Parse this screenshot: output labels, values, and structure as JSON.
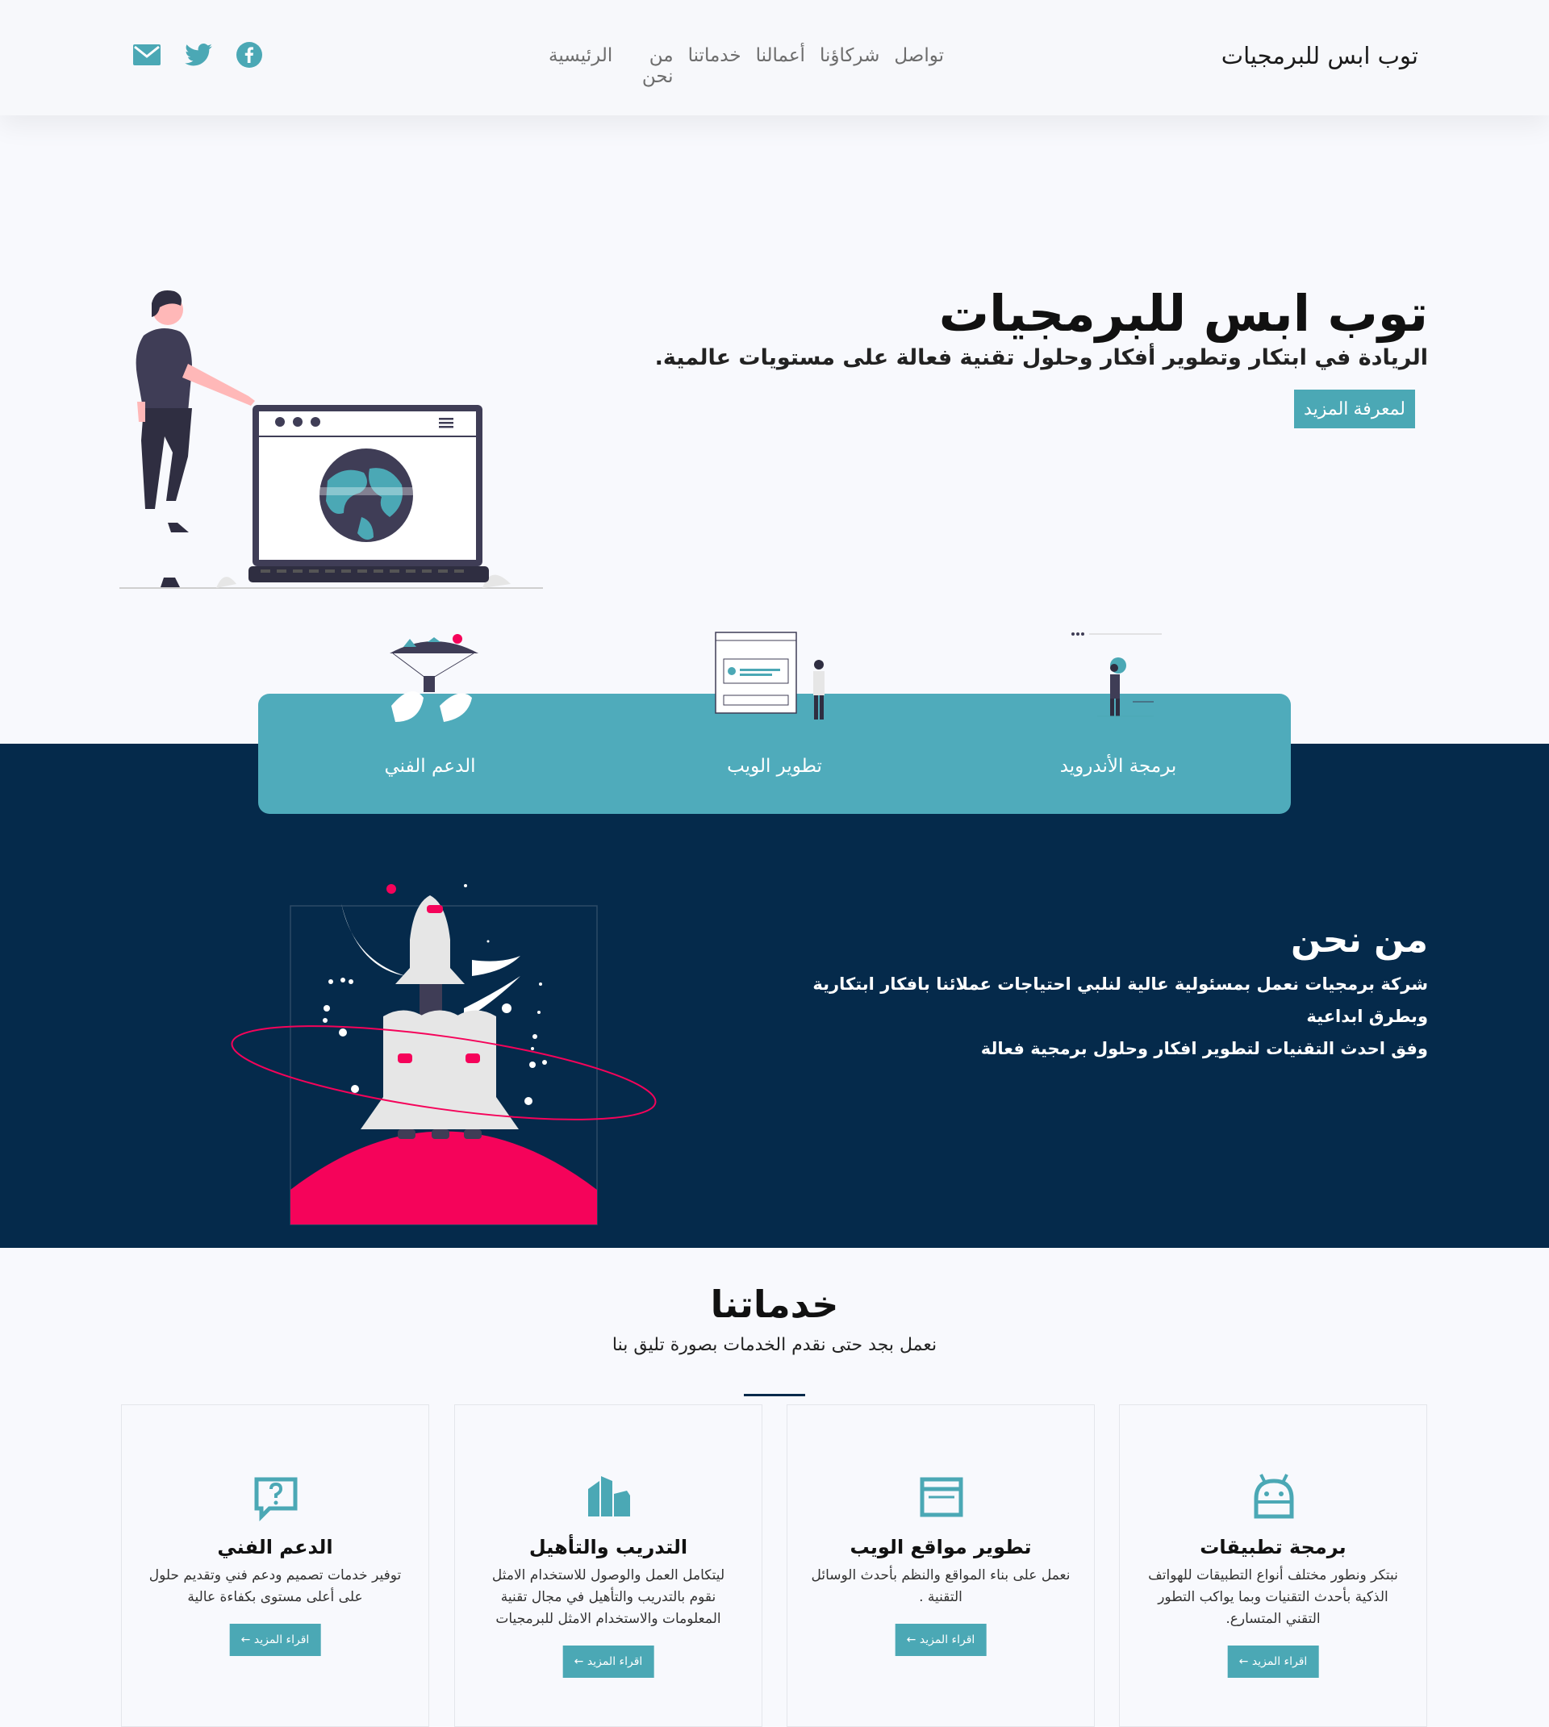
{
  "header": {
    "brand": "توب ابس للبرمجيات",
    "nav": [
      "الرئيسية",
      "من نحن",
      "خدماتنا",
      "أعمالنا",
      "شركاؤنا",
      "تواصل"
    ]
  },
  "social": {
    "icons": [
      "facebook-icon",
      "twitter-icon",
      "mail-icon"
    ],
    "color": "#4ba8b5"
  },
  "hero": {
    "title": "توب ابس للبرمجيات",
    "subtitle": "الريادة في ابتكار وتطوير أفكار وحلول تقنية فعالة على مستويات عالمية.",
    "button": "لمعرفة المزيد"
  },
  "features": [
    {
      "label": "برمجة الأندرويد"
    },
    {
      "label": "تطوير الويب"
    },
    {
      "label": "الدعم الفني"
    }
  ],
  "about": {
    "title": "من نحن",
    "line1": "شركة برمجيات نعمل بمسئولية عالية لنلبي احتياجات عملائنا بافكار ابتكارية وبطرق ابداعية",
    "line2": "وفق احدث التقنيات لتطوير افكار وحلول برمجية فعالة"
  },
  "services": {
    "title": "خدماتنا",
    "subtitle": "نعمل بجد حتى نقدم الخدمات بصورة تليق بنا",
    "cards": [
      {
        "icon": "android-icon",
        "title": "برمجة تطبيقات",
        "text": "نبتكر ونطور مختلف أنواع التطبيقات للهواتف الذكية بأحدث التقنيات وبما يواكب التطور التقني المتسارع.",
        "button": "اقراء المزيد ←"
      },
      {
        "icon": "browser-icon",
        "title": "تطوير مواقع الويب",
        "text": "نعمل على بناء المواقع والنظم بأحدث الوسائل التقنية .",
        "button": "اقراء المزيد ←"
      },
      {
        "icon": "buildings-icon",
        "title": "التدريب والتأهيل",
        "text": "ليتكامل العمل والوصول للاستخدام الامثل نقوم بالتدريب والتأهيل في مجال تقنية المعلومات والاستخدام الامثل للبرمجيات",
        "button": "اقراء المزيد ←"
      },
      {
        "icon": "question-chat-icon",
        "title": "الدعم الفني",
        "text": "توفير خدمات تصميم ودعم فني وتقديم حلول على أعلى مستوى بكفاءة عالية",
        "button": "اقراء المزيد ←"
      }
    ]
  },
  "colors": {
    "accent": "#4ba8b5",
    "dark": "#052a4b",
    "pink": "#f5035a"
  }
}
